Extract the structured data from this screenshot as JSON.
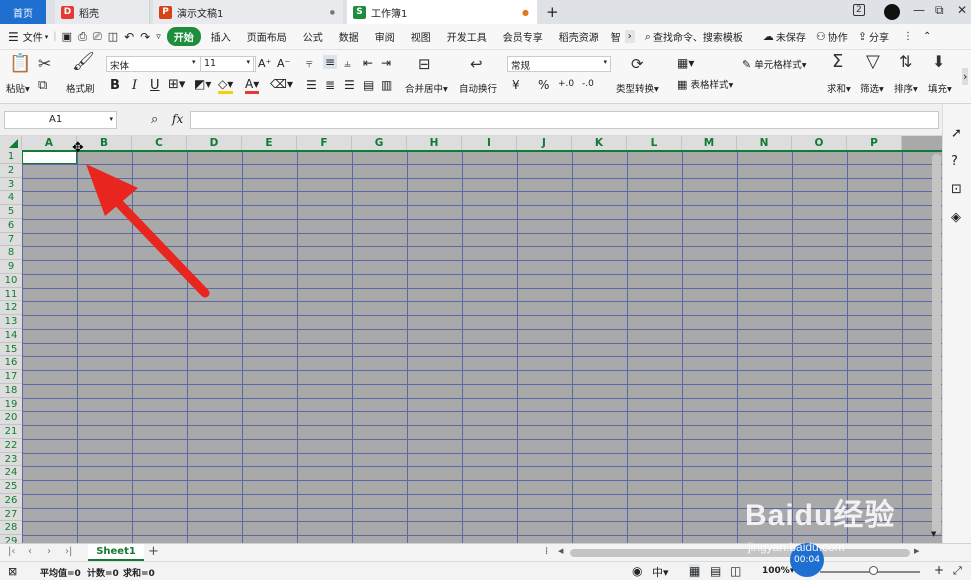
{
  "tabs": [
    {
      "label": "首页",
      "active": false
    },
    {
      "label": "稻壳",
      "active": false
    },
    {
      "label": "演示文稿1",
      "active": false
    },
    {
      "label": "工作簿1",
      "active": true
    }
  ],
  "tab_icons": {
    "docer": "D",
    "ppt": "P",
    "sheet": "S"
  },
  "window": {
    "page_badge": "2",
    "minimize": "—",
    "restore": "⧉",
    "close": "✕"
  },
  "menu": {
    "file": "文件",
    "tabs": [
      "开始",
      "插入",
      "页面布局",
      "公式",
      "数据",
      "审阅",
      "视图",
      "开发工具",
      "会员专享",
      "稻壳资源",
      "智"
    ],
    "active": "开始",
    "search": "查找命令、搜索模板",
    "unsaved": "未保存",
    "collab": "协作",
    "share": "分享"
  },
  "ribbon": {
    "paste": "粘贴",
    "format_painter": "格式刷",
    "font_name": "宋体",
    "font_size": "11",
    "merge_center": "合并居中",
    "wrap": "自动换行",
    "number_format": "常规",
    "type_convert": "类型转换",
    "cell_style": "单元格样式",
    "table_style": "表格样式",
    "sum": "求和",
    "filter": "筛选",
    "sort": "排序",
    "fill": "填充",
    "bold": "B",
    "italic": "I",
    "underline": "U",
    "currency": "¥",
    "percent": "%",
    "decimals_up": "+.0",
    "decimals_down": "-.0"
  },
  "formula_bar": {
    "name_box": "A1",
    "fx": "fx",
    "value": ""
  },
  "columns": [
    "A",
    "B",
    "C",
    "D",
    "E",
    "F",
    "G",
    "H",
    "I",
    "J",
    "K",
    "L",
    "M",
    "N",
    "O",
    "P"
  ],
  "rows": [
    "1",
    "2",
    "3",
    "4",
    "5",
    "6",
    "7",
    "8",
    "9",
    "10",
    "11",
    "12",
    "13",
    "14",
    "15",
    "16",
    "17",
    "18",
    "19",
    "20",
    "21",
    "22",
    "23",
    "24",
    "25",
    "26",
    "27",
    "28",
    "29"
  ],
  "sheet_tabs": [
    "Sheet1"
  ],
  "active_sheet": "Sheet1",
  "status": {
    "avg": "平均值=0",
    "count": "计数=0",
    "sum": "求和=0",
    "zoom": "100%",
    "timer": "00:04"
  },
  "watermark": {
    "brand": "Baidu经验",
    "url": "jingyan.baidu.com"
  },
  "colors": {
    "accent_green": "#117a33",
    "active_tab_green": "#1e8e3e",
    "selection": "#a9a9a9",
    "arrow": "#e8251f",
    "blue_tab": "#1f6fd1"
  }
}
